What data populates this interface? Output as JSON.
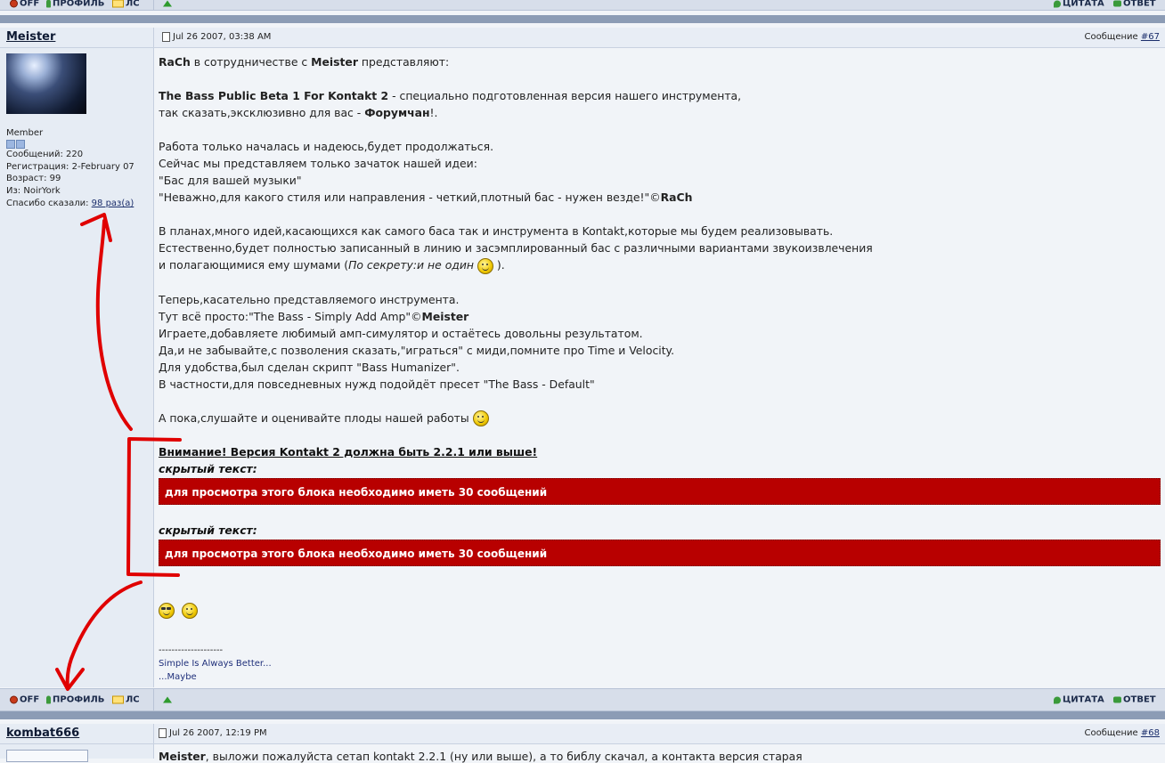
{
  "toolbar": {
    "off_label": "OFF",
    "profile_label": "ПРОФИЛЬ",
    "pm_label": "ЛС",
    "quote_label": "ЦИТАТА",
    "reply_label": "ОТВЕТ"
  },
  "post67": {
    "author": "Meister",
    "date": "Jul 26 2007, 03:38 AM",
    "number_label": "Сообщение",
    "number": "#67",
    "user_info": {
      "group": "Member",
      "posts": "Сообщений: 220",
      "registered": "Регистрация: 2-February 07",
      "age": "Возраст: 99",
      "from": "Из: NoirYork",
      "thanks_label": "Спасибо сказали:",
      "thanks_link": "98 раз(а)"
    },
    "body": {
      "l1_bold": "RaCh",
      "l1_mid": " в сотрудничестве с ",
      "l1_bold2": "Meister",
      "l1_end": " представляют:",
      "l2_bold": "The Bass Public Beta 1 For Kontakt 2",
      "l2_end": " - специально подготовленная версия нашего инструмента,",
      "l3_start": "так сказать,эксклюзивно для вас - ",
      "l3_bold": "Форумчан",
      "l3_end": "!.",
      "l4": "Работа только началась и надеюсь,будет продолжаться.",
      "l5": "Сейчас мы представляем только зачаток нашей идеи:",
      "l6": "\"Бас для вашей музыки\"",
      "l7_start": "\"Неважно,для какого стиля или направления - четкий,плотный бас - нужен везде!\"©",
      "l7_bold": "RaCh",
      "l8": "В планах,много идей,касающихся как самого баса так и инструмента в Kontakt,которые мы будем реализовывать.",
      "l9": "Естественно,будет полностью записанный в линию и засэмплированный бас с различными вариантами звукоизвлечения",
      "l10_start": "и полагающимися ему шумами (",
      "l10_italic": "По секрету:и не один",
      "l10_end": " ).",
      "l11": "Теперь,касательно представляемого инструмента.",
      "l12_start": "Тут всё просто:\"The Bass - Simply Add Amp\"©",
      "l12_bold": "Meister",
      "l13": "Играете,добавляете любимый амп-симулятор и остаётесь довольны результатом.",
      "l14": "Да,и не забывайте,с позволения сказать,\"играться\" с миди,помните про Time и Velocity.",
      "l15": "Для удобства,был сделан скрипт \"Bass Humanizer\".",
      "l16": "В частности,для повседневных нужд подойдёт пресет \"The Bass - Default\"",
      "l17": "А пока,слушайте и оценивайте плоды нашей работы",
      "warning": "Внимание! Версия Kontakt 2 должна быть 2.2.1 или выше!",
      "hidden_label": "скрытый текст:",
      "hidden_block": "для просмотра этого блока необходимо иметь 30 сообщений"
    },
    "signature": {
      "dashes": "--------------------",
      "line1": "Simple Is Always Better...",
      "line2": "...Maybe"
    }
  },
  "post68": {
    "author": "kombat666",
    "date": "Jul 26 2007, 12:19 PM",
    "number_label": "Сообщение",
    "number": "#68",
    "preview_bold": "Meister",
    "preview_text": ", выложи пожалуйста сетап kontakt 2.2.1 (ну или выше), а то библу скачал, а контакта версия старая"
  },
  "annotation_color": "#e00000"
}
